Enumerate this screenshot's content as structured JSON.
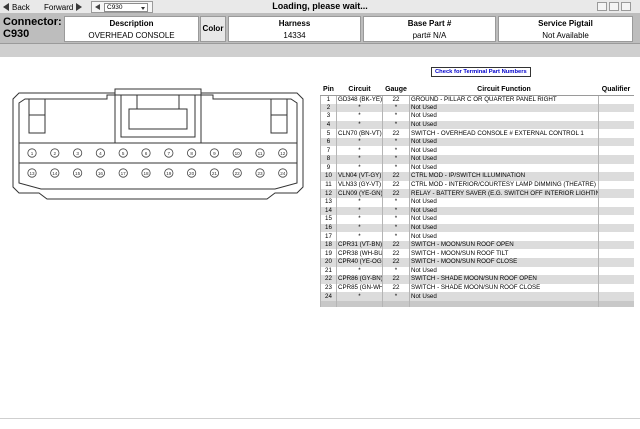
{
  "toolbar": {
    "back_label": "Back",
    "forward_label": "Forward",
    "nav_select_value": "C930",
    "status_text": "Loading, please wait..."
  },
  "header": {
    "connector_label": "Connector:",
    "connector_id": "C930",
    "description_heading": "Description",
    "description_value": "OVERHEAD CONSOLE",
    "color_heading": "Color",
    "harness_heading": "Harness",
    "harness_value": "14334",
    "base_part_heading": "Base Part #",
    "base_part_value": "part# N/A",
    "service_pigtail_heading": "Service Pigtail",
    "service_pigtail_value": "Not Available"
  },
  "terminal_button_label": "Check for Terminal Part Numbers",
  "connector_diagram": {
    "top_row_pins": [
      "1",
      "2",
      "3",
      "4",
      "5",
      "6",
      "7",
      "8",
      "9",
      "10",
      "11",
      "12"
    ],
    "bottom_row_pins": [
      "13",
      "14",
      "15",
      "16",
      "17",
      "18",
      "19",
      "20",
      "21",
      "22",
      "23",
      "24"
    ]
  },
  "pin_table": {
    "headers": [
      "Pin",
      "Circuit",
      "Gauge",
      "Circuit Function",
      "Qualifier"
    ],
    "rows": [
      {
        "pin": "1",
        "circuit": "GD348 (BK-YE)",
        "gauge": "22",
        "function": "GROUND - PILLAR C OR QUARTER PANEL RIGHT",
        "qualifier": ""
      },
      {
        "pin": "2",
        "circuit": "*",
        "gauge": "*",
        "function": "Not Used",
        "qualifier": ""
      },
      {
        "pin": "3",
        "circuit": "*",
        "gauge": "*",
        "function": "Not Used",
        "qualifier": ""
      },
      {
        "pin": "4",
        "circuit": "*",
        "gauge": "*",
        "function": "Not Used",
        "qualifier": ""
      },
      {
        "pin": "5",
        "circuit": "CLN70 (BN-VT)",
        "gauge": "22",
        "function": "SWITCH - OVERHEAD CONSOLE # EXTERNAL CONTROL 1",
        "qualifier": ""
      },
      {
        "pin": "6",
        "circuit": "*",
        "gauge": "*",
        "function": "Not Used",
        "qualifier": ""
      },
      {
        "pin": "7",
        "circuit": "*",
        "gauge": "*",
        "function": "Not Used",
        "qualifier": ""
      },
      {
        "pin": "8",
        "circuit": "*",
        "gauge": "*",
        "function": "Not Used",
        "qualifier": ""
      },
      {
        "pin": "9",
        "circuit": "*",
        "gauge": "*",
        "function": "Not Used",
        "qualifier": ""
      },
      {
        "pin": "10",
        "circuit": "VLN04 (VT-GY)",
        "gauge": "22",
        "function": "CTRL MOD - IP/SWITCH ILLUMINATION",
        "qualifier": ""
      },
      {
        "pin": "11",
        "circuit": "VLN33 (GY-VT)",
        "gauge": "22",
        "function": "CTRL MOD - INTERIOR/COURTESY LAMP DIMMING (THEATRE)",
        "qualifier": ""
      },
      {
        "pin": "12",
        "circuit": "CLN09 (YE-GN)",
        "gauge": "22",
        "function": "RELAY - BATTERY SAVER (E.G. SWITCH OFF INTERIOR LIGHTING)",
        "qualifier": ""
      },
      {
        "pin": "13",
        "circuit": "*",
        "gauge": "*",
        "function": "Not Used",
        "qualifier": ""
      },
      {
        "pin": "14",
        "circuit": "*",
        "gauge": "*",
        "function": "Not Used",
        "qualifier": ""
      },
      {
        "pin": "15",
        "circuit": "*",
        "gauge": "*",
        "function": "Not Used",
        "qualifier": ""
      },
      {
        "pin": "16",
        "circuit": "*",
        "gauge": "*",
        "function": "Not Used",
        "qualifier": ""
      },
      {
        "pin": "17",
        "circuit": "*",
        "gauge": "*",
        "function": "Not Used",
        "qualifier": ""
      },
      {
        "pin": "18",
        "circuit": "CPR31 (VT-BN)",
        "gauge": "22",
        "function": "SWITCH - MOON/SUN ROOF OPEN",
        "qualifier": ""
      },
      {
        "pin": "19",
        "circuit": "CPR38 (WH-BU)",
        "gauge": "22",
        "function": "SWITCH - MOON/SUN ROOF TILT",
        "qualifier": ""
      },
      {
        "pin": "20",
        "circuit": "CPR40 (YE-OG)",
        "gauge": "22",
        "function": "SWITCH - MOON/SUN ROOF CLOSE",
        "qualifier": ""
      },
      {
        "pin": "21",
        "circuit": "*",
        "gauge": "*",
        "function": "Not Used",
        "qualifier": ""
      },
      {
        "pin": "22",
        "circuit": "CPR86 (GY-BN)",
        "gauge": "22",
        "function": "SWITCH - SHADE MOON/SUN ROOF OPEN",
        "qualifier": ""
      },
      {
        "pin": "23",
        "circuit": "CPR85 (GN-WH)",
        "gauge": "22",
        "function": "SWITCH - SHADE MOON/SUN ROOF CLOSE",
        "qualifier": ""
      },
      {
        "pin": "24",
        "circuit": "*",
        "gauge": "*",
        "function": "Not Used",
        "qualifier": ""
      }
    ]
  }
}
